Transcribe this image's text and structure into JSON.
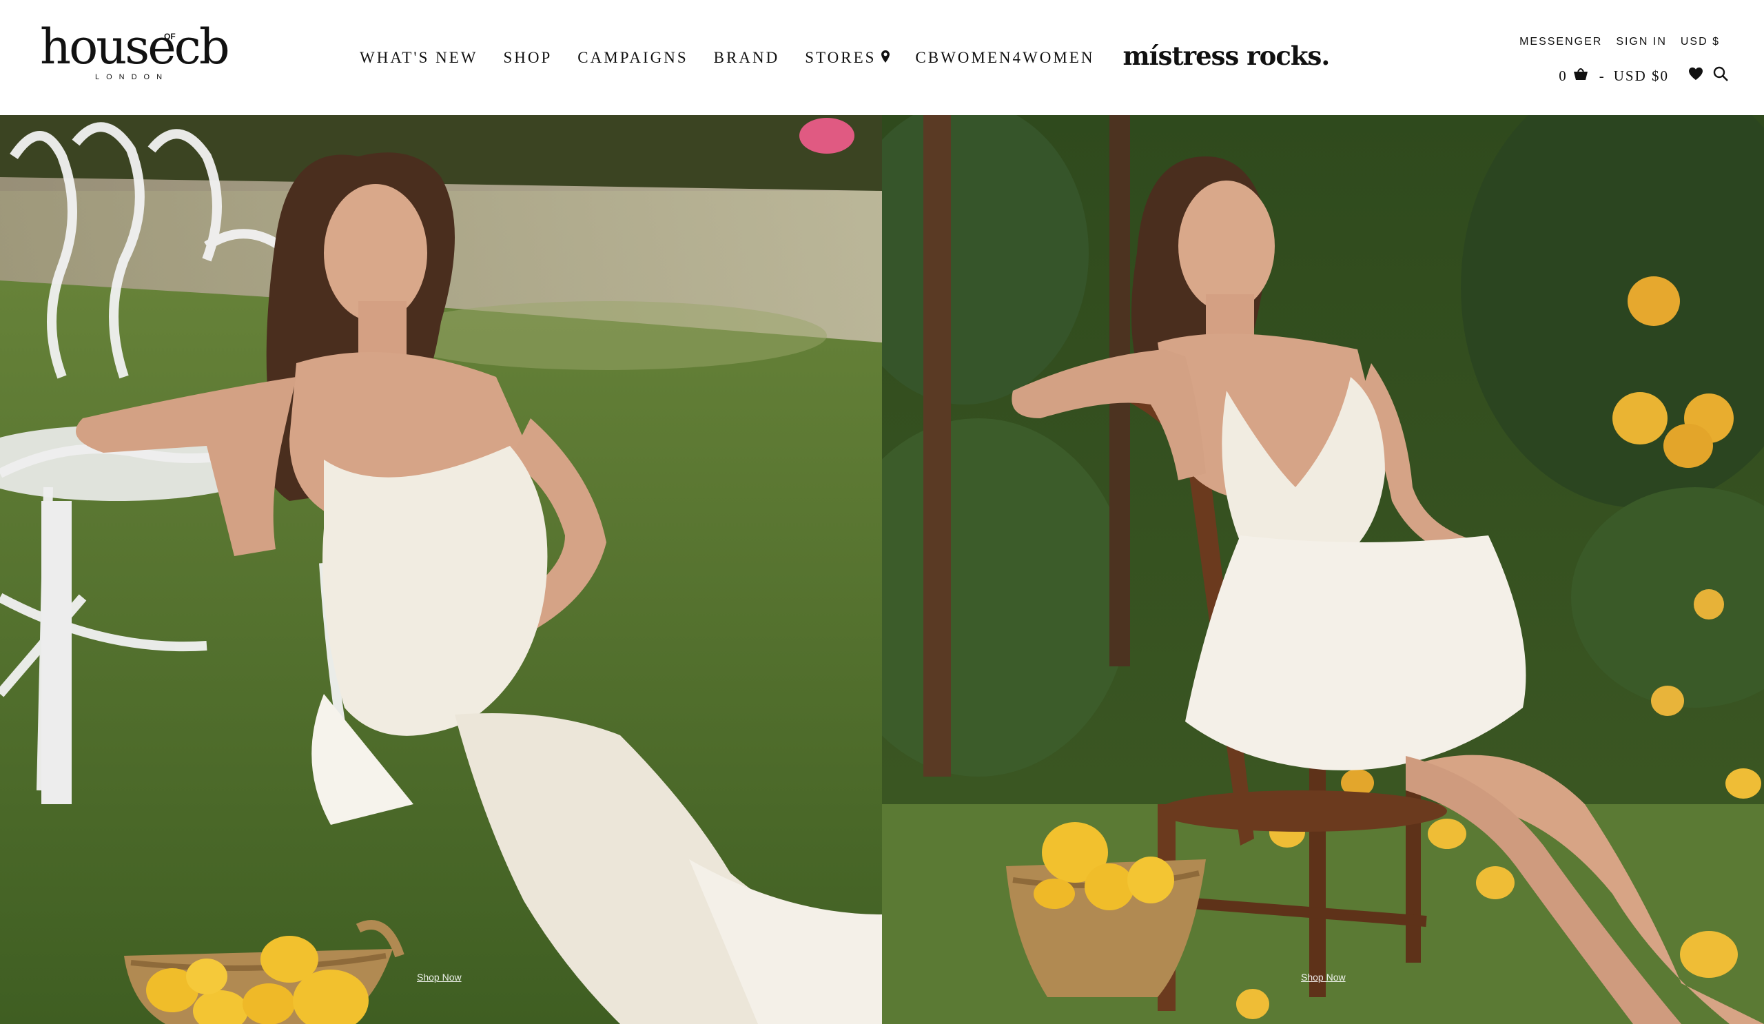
{
  "brand": {
    "logo_main": "housecb",
    "logo_of": "OF",
    "logo_sub": "LONDON"
  },
  "nav": {
    "items": [
      {
        "label": "WHAT'S NEW"
      },
      {
        "label": "SHOP"
      },
      {
        "label": "CAMPAIGNS"
      },
      {
        "label": "BRAND"
      },
      {
        "label": "STORES",
        "icon": "map-pin-icon"
      },
      {
        "label": "CBWOMEN4WOMEN"
      }
    ],
    "mistress_label": "místress rocks."
  },
  "utility": {
    "messenger": "MESSENGER",
    "sign_in": "SIGN IN",
    "currency": "USD $"
  },
  "cart": {
    "count": "0",
    "separator": "-",
    "total": "USD $0",
    "icons": [
      "basket-icon",
      "heart-icon",
      "search-icon"
    ]
  },
  "hero": {
    "left": {
      "cta": "Shop Now"
    },
    "right": {
      "cta": "Shop Now"
    }
  },
  "colors": {
    "grass": "#56762e",
    "dress": "#f1ece1",
    "hair": "#4a2e1e",
    "skin": "#d9a88a",
    "lemon": "#f2c12e",
    "foliage": "#2f4a1d",
    "wood": "#6b3a1e",
    "basket": "#b18a52"
  }
}
